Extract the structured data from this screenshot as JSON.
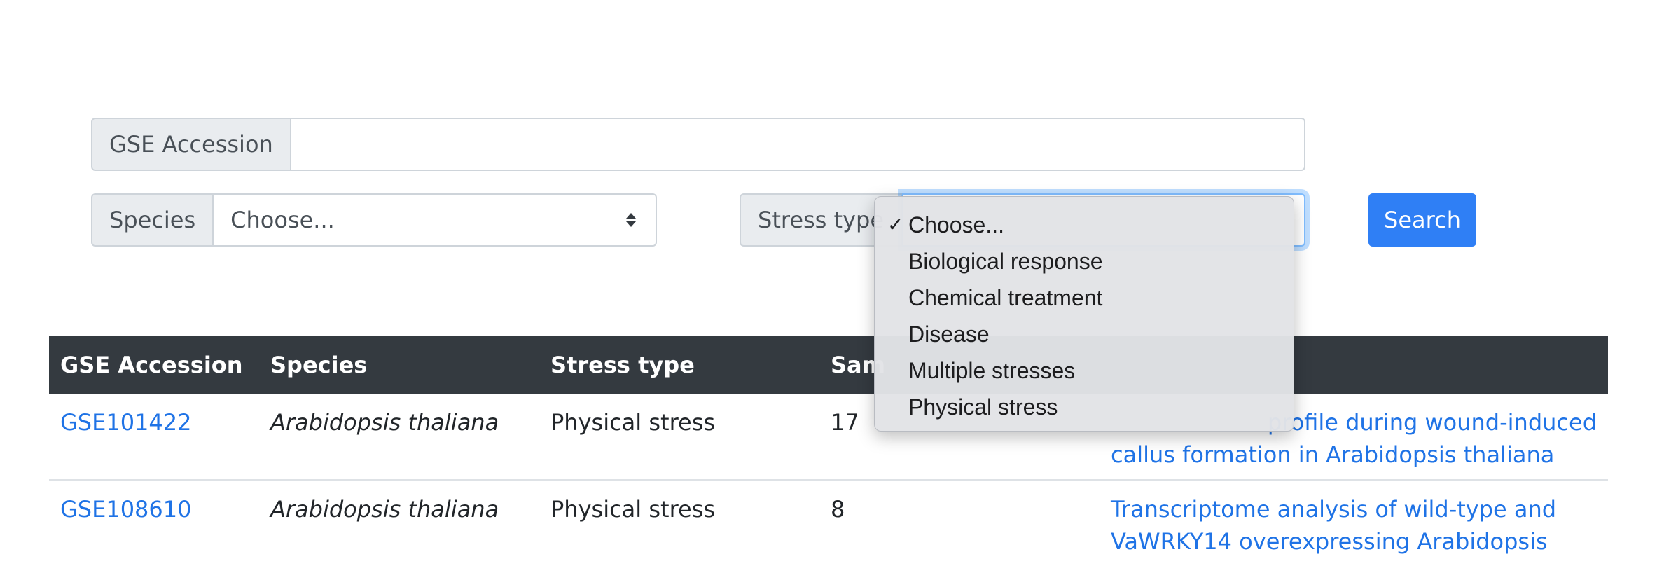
{
  "form": {
    "gse_accession": {
      "label": "GSE Accession",
      "value": ""
    },
    "species": {
      "label": "Species",
      "selected": "Choose..."
    },
    "stress_type": {
      "label": "Stress type"
    },
    "search_button": "Search"
  },
  "dropdown": {
    "check": "✓",
    "options": [
      "Choose...",
      "Biological response",
      "Chemical treatment",
      "Disease",
      "Multiple stresses",
      "Physical stress"
    ]
  },
  "table": {
    "headers": [
      "GSE Accession",
      "Species",
      "Stress type",
      "Sam",
      "",
      ""
    ],
    "rows": [
      {
        "accession": "GSE101422",
        "species": "Arabidopsis thaliana",
        "stress": "Physical stress",
        "samples": "17",
        "title_line1": "profile during wound-induced",
        "title_line2": "callus formation in Arabidopsis thaliana"
      },
      {
        "accession": "GSE108610",
        "species": "Arabidopsis thaliana",
        "stress": "Physical stress",
        "samples": "8",
        "title_line1": "Transcriptome analysis of wild-type and",
        "title_line2": "VaWRKY14 overexpressing Arabidopsis"
      }
    ]
  },
  "colors": {
    "primary": "#2f7ff5",
    "link": "#1f73e6",
    "table_header_bg": "#343a40",
    "addon_bg": "#e9ecef"
  }
}
